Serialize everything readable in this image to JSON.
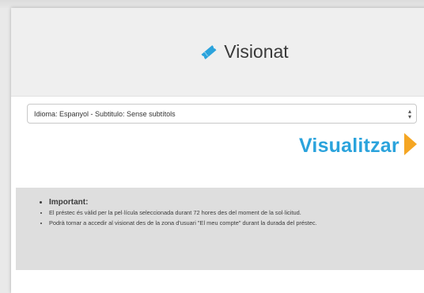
{
  "header": {
    "title": "Visionat",
    "icon": "ticket-icon",
    "icon_color": "#2ba3dc"
  },
  "language_select": {
    "value": "Idioma: Espanyol - Subtitulo: Sense subtítols"
  },
  "watch_button": {
    "label": "Visualitzar",
    "color": "#2ba3dc",
    "icon": "play-icon",
    "icon_color": "#f5a623"
  },
  "notice": {
    "heading": "Important:",
    "items": [
      "El préstec és vàlid per la pel·lícula seleccionada durant 72 hores des del moment de la sol·licitud.",
      "Podrà tornar a accedir al visionat des de la zona d'usuari \"El meu compte\" durant la durada del préstec."
    ]
  }
}
